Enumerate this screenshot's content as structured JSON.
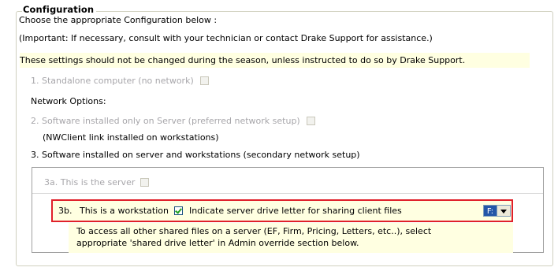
{
  "config": {
    "legend": "Configuration",
    "intro": "Choose the appropriate Configuration below :",
    "important": "(Important: If necessary, consult with your technician or contact Drake Support for assistance.)",
    "warning": "These settings should not be changed during the season, unless instructed to do so by Drake Support.",
    "option1_label": "1. Standalone computer (no network)",
    "network_heading": "Network Options:",
    "option2_label": "2.  Software installed only on Server (preferred network setup)",
    "option2_note": "(NWClient link installed on workstations)",
    "option3_label": "3.  Software installed on server and workstations (secondary network setup)",
    "option3a_label": "3a.  This is the server",
    "option3b_prefix": "3b.",
    "option3b_label": "This is a workstation",
    "drive_letter_label": "Indicate server drive letter for sharing client files",
    "drive_letter_value": "F:",
    "info_line1": "To access all other shared files on a server (EF, Firm, Pricing, Letters, etc..), select",
    "info_line2": "appropriate 'shared drive letter' in Admin override section below."
  },
  "colors": {
    "highlight": "#ffffe1",
    "disabled_text": "#a7a6aa",
    "red_outline": "#e0202a",
    "dropdown_selected": "#2456a8"
  },
  "state": {
    "option1_checked": false,
    "option2_checked": false,
    "option3a_checked": false,
    "option3b_checked": true
  }
}
